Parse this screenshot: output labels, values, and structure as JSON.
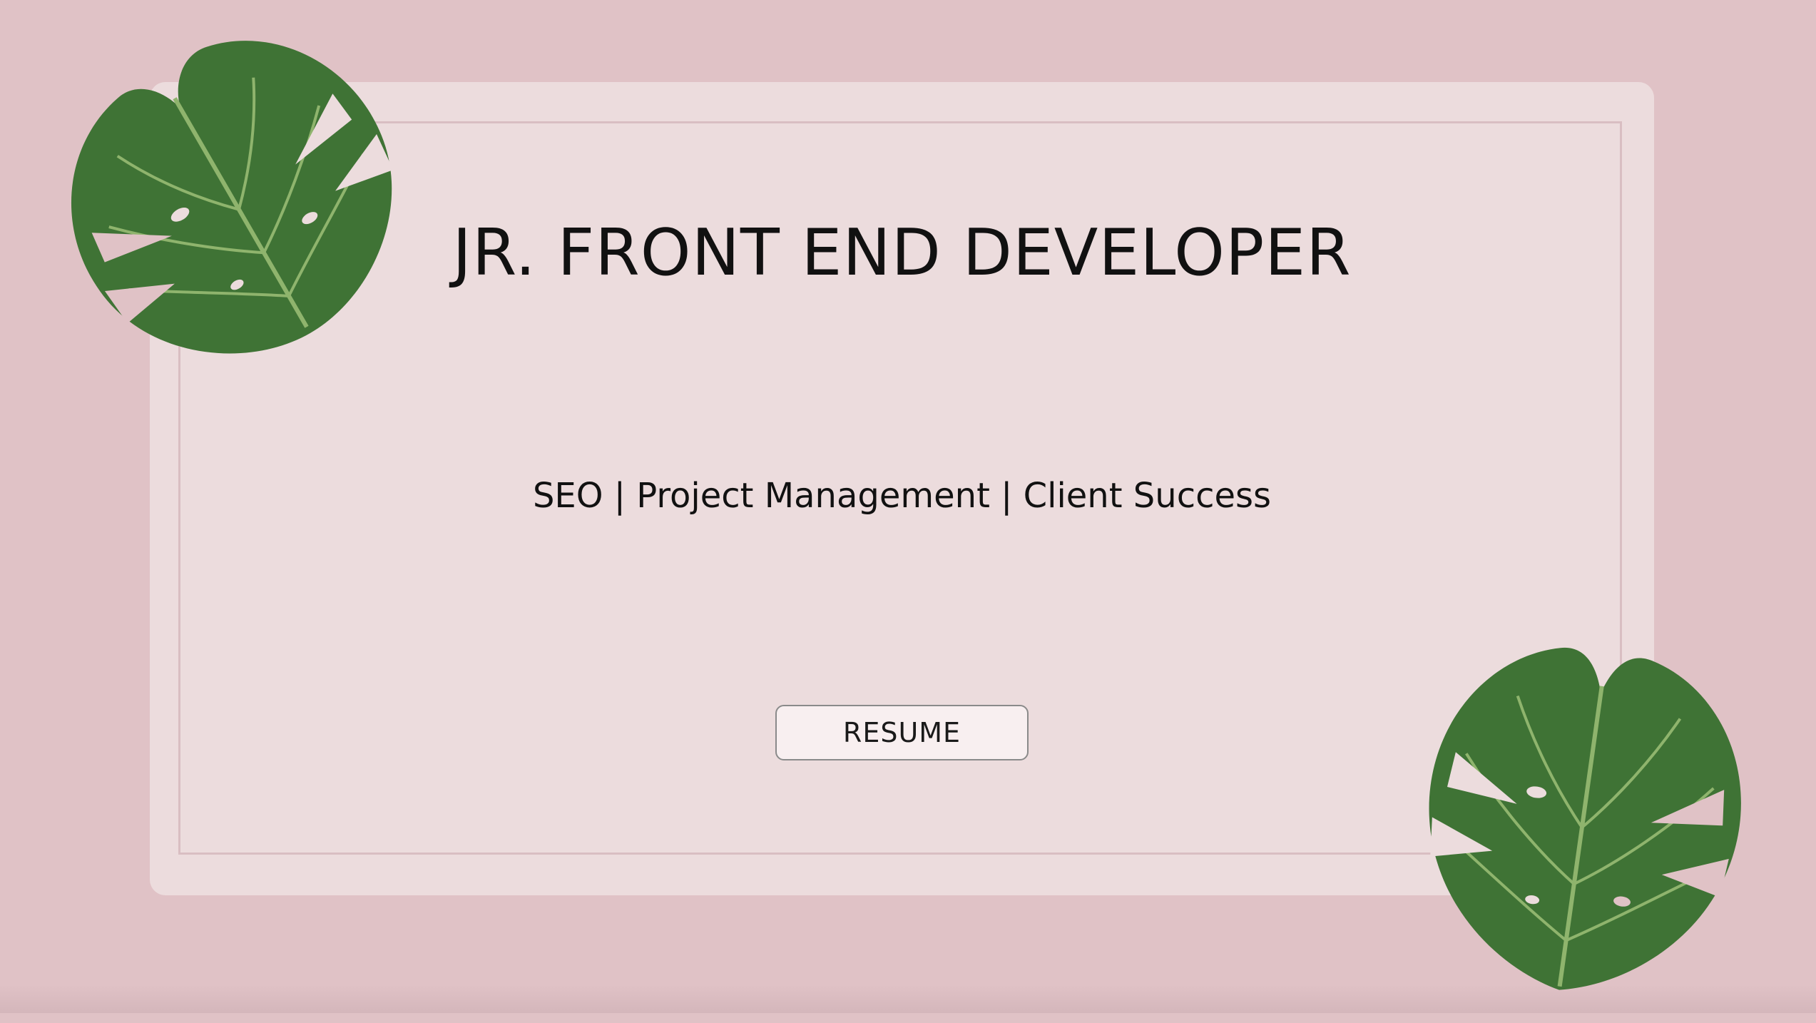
{
  "hero": {
    "title": "JR. FRONT END DEVELOPER",
    "subtitle": "SEO | Project Management | Client Success",
    "resume_button_label": "RESUME"
  },
  "decor": {
    "leaf_top_left_icon": "monstera-leaf-icon",
    "leaf_bottom_right_icon": "monstera-leaf-icon"
  },
  "colors": {
    "page_background": "#e0c2c6",
    "card_background": "#ecdcdd",
    "frame_border": "#d9bec2",
    "leaf_dark": "#3f7335",
    "leaf_vein": "#8fb46d",
    "text": "#111111"
  }
}
